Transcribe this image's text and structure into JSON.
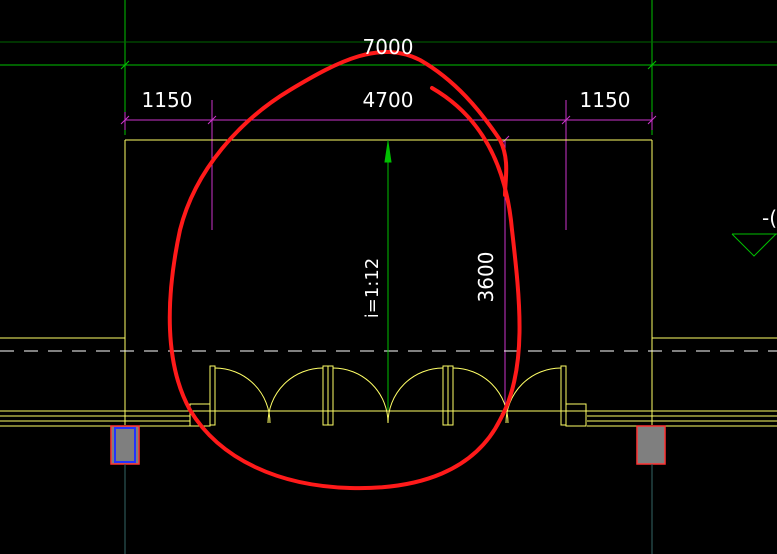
{
  "drawing": {
    "dimensions": {
      "overall": "7000",
      "left": "1150",
      "center": "4700",
      "right": "1150",
      "height": "3600",
      "slope": "i=1:12"
    },
    "clipped_label": "-(",
    "colors": {
      "background": "#000000",
      "axis_line": "#00c000",
      "outline": "#ffff66",
      "dimension_line": "#cc33cc",
      "annotation_circle": "#ff1a1a",
      "column_fill": "#7f7f7f",
      "column_border_left": "#2233ff",
      "column_border_right": "#ff3333"
    }
  }
}
